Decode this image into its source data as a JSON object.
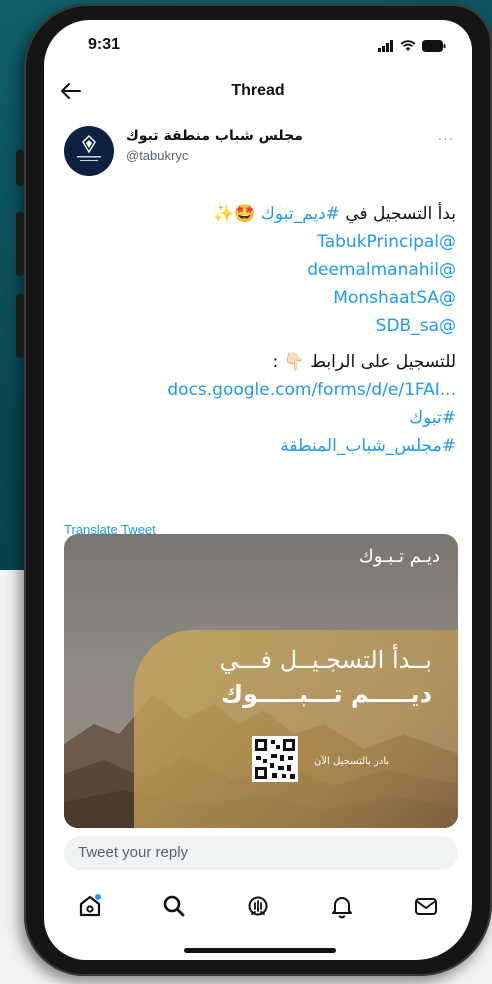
{
  "status_bar": {
    "time": "9:31"
  },
  "header": {
    "title": "Thread"
  },
  "tweet": {
    "author_name": "مجلس شباب منطقة تبوك",
    "author_handle": "@tabukryc",
    "more": "···",
    "line1_text": "بدأ التسجيل في ",
    "line1_hashtag": "#ديم_تبوك",
    "line1_emoji": " 🤩✨",
    "mentions": [
      "@TabukPrincipal",
      "@deemalmanahil",
      "@MonshaatSA",
      "@SDB_sa"
    ],
    "link_intro": "للتسجيل على الرابط 👇🏻 :",
    "url": "docs.google.com/forms/d/e/1FAI...",
    "hashtags": [
      "#تبوك",
      "#مجلس_شباب_المنطقة"
    ],
    "translate": "Translate Tweet"
  },
  "card": {
    "brand": "ديـم تـبـوك",
    "line1": "بــدأ التسجـيــل فـــي",
    "line2": "ديـــــم تـــبـــــوك",
    "qr_caption": "بادر بالتسجيل الآن"
  },
  "reply": {
    "placeholder": "Tweet your reply"
  },
  "tabbar": {
    "items": [
      "home",
      "search",
      "spaces",
      "notifications",
      "messages"
    ]
  },
  "colors": {
    "accent": "#1d9bf0",
    "backdrop": "#0a4753",
    "text": "#111111",
    "muted": "#536471"
  }
}
